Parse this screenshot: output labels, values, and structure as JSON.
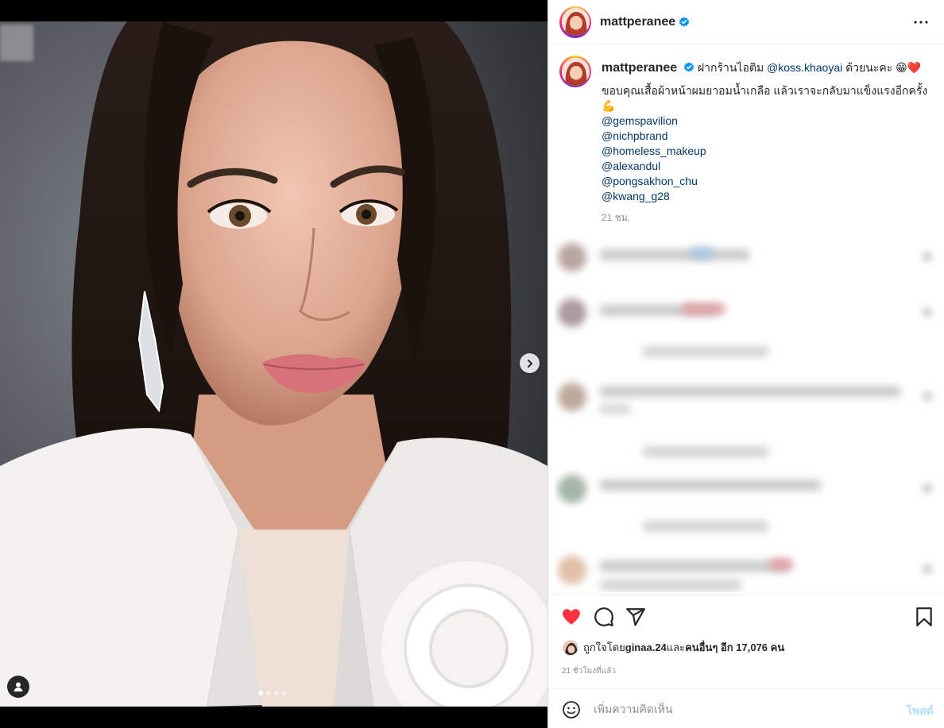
{
  "post": {
    "username": "mattperanee",
    "verified": true
  },
  "caption": {
    "username": "mattperanee",
    "text_before_mention": " ฝากร้านไอติม ",
    "mention": "@koss.khaoyai",
    "text_after_mention": " ด้วยนะคะ 😁❤️",
    "line2": "ขอบคุณเสื้อผ้าหน้าผมยาอมน้ำเกลือ แล้วเราจะกลับมาแข็งแรงอีกครั้ง",
    "line2_emoji": "💪",
    "mentions": [
      "@gemspavilion",
      "@nichpbrand",
      "@homeless_makeup",
      "@alexandul",
      "@pongsakhon_chu",
      "@kwang_g28"
    ],
    "time": "21 ชม."
  },
  "likes": {
    "prefix": "ถูกใจโดย ",
    "user": "ginaa.24",
    "middle": " และ",
    "others": "คนอื่นๆ อีก 17,076 คน"
  },
  "post_time": "21 ชั่วโมงที่แล้ว",
  "comment_box": {
    "placeholder": "เพิ่มความคิดเห็น",
    "post_label": "โพสต์"
  },
  "carousel": {
    "total": 4,
    "current": 1
  },
  "icons": {
    "more": "more-options-icon",
    "like": "heart-filled-icon",
    "comment": "comment-icon",
    "share": "share-icon",
    "save": "bookmark-icon",
    "next": "chevron-right-icon",
    "tag": "user-tag-icon",
    "emoji": "emoji-icon"
  },
  "colors": {
    "like": "#ff3040",
    "mention": "#00376b",
    "verified": "#0095f6",
    "post_button": "#b2dffc"
  }
}
